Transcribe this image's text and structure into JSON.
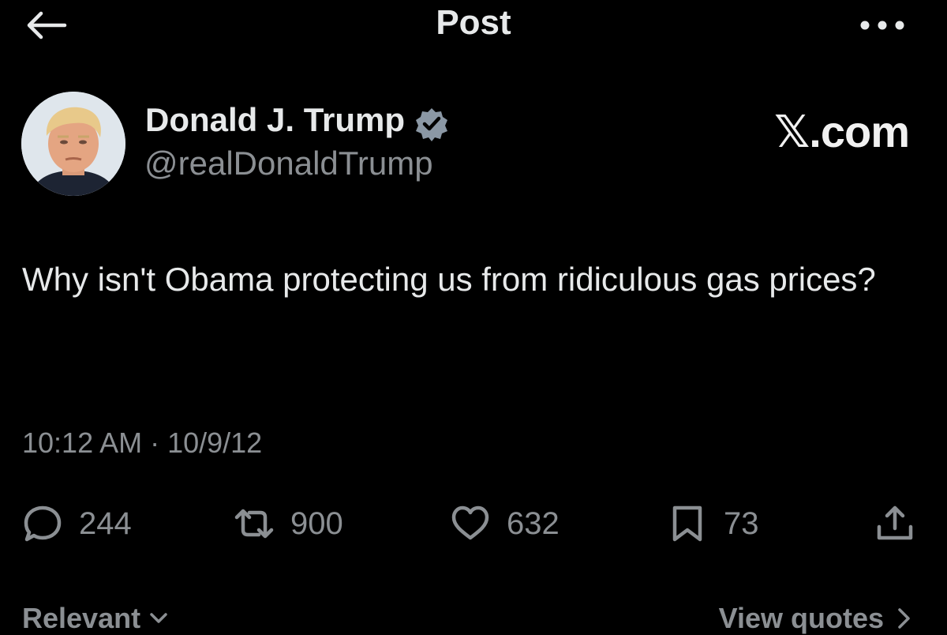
{
  "header": {
    "title": "Post",
    "back_icon": "arrow-left-icon",
    "more_icon": "more-horizontal-icon"
  },
  "author": {
    "name": "Donald J. Trump",
    "handle": "@realDonaldTrump",
    "verified": true,
    "verified_color": "#8b98a5"
  },
  "watermark": "𝕏.com",
  "post": {
    "text": "Why isn't Obama protecting us from ridiculous gas prices?",
    "timestamp": "10:12 AM · 10/9/12"
  },
  "actions": {
    "replies": "244",
    "reposts": "900",
    "likes": "632",
    "bookmarks": "73"
  },
  "footer": {
    "sort_label": "Relevant",
    "quotes_label": "View quotes"
  },
  "colors": {
    "background": "#000000",
    "primary_text": "#e7e9ea",
    "secondary_text": "#8b8f93"
  }
}
